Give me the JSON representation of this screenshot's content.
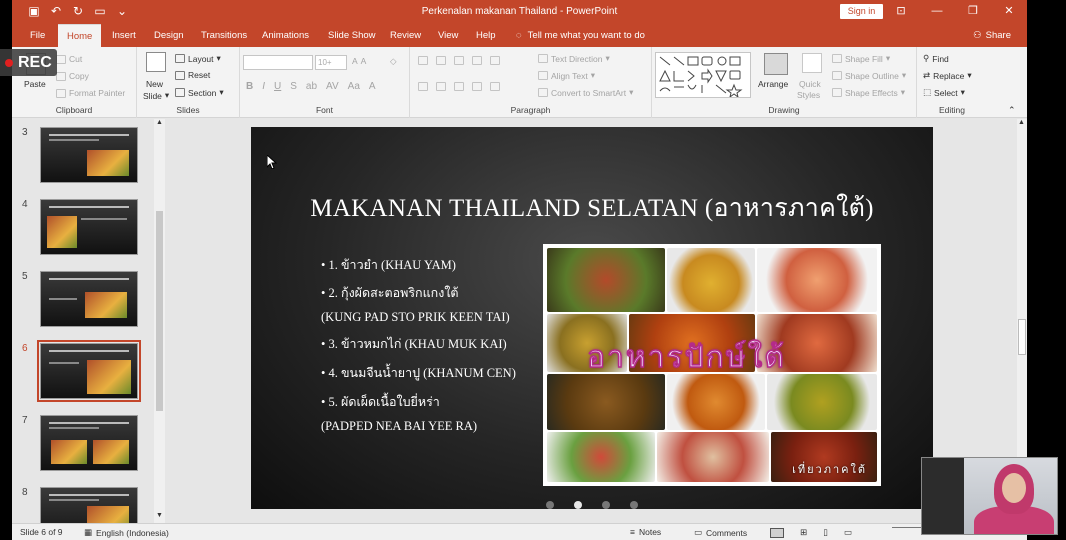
{
  "app": {
    "window_title": "Perkenalan makanan Thailand  -  PowerPoint",
    "sign_in": "Sign in",
    "share": "Share",
    "tell_me": "Tell me what you want to do"
  },
  "tabs": [
    "File",
    "Home",
    "Insert",
    "Design",
    "Transitions",
    "Animations",
    "Slide Show",
    "Review",
    "View",
    "Help"
  ],
  "active_tab": "Home",
  "ribbon": {
    "clipboard": {
      "label": "Clipboard",
      "paste": "Paste",
      "cut": "Cut",
      "copy": "Copy",
      "format_painter": "Format Painter"
    },
    "slides": {
      "label": "Slides",
      "new_slide_1": "New",
      "new_slide_2": "Slide",
      "layout": "Layout",
      "reset": "Reset",
      "section": "Section"
    },
    "font": {
      "label": "Font",
      "size": "10+"
    },
    "paragraph": {
      "label": "Paragraph",
      "text_direction": "Text Direction",
      "align_text": "Align Text",
      "smartart": "Convert to SmartArt"
    },
    "drawing": {
      "label": "Drawing",
      "arrange": "Arrange",
      "quick_styles_1": "Quick",
      "quick_styles_2": "Styles",
      "shape_fill": "Shape Fill",
      "shape_outline": "Shape Outline",
      "shape_effects": "Shape Effects"
    },
    "editing": {
      "label": "Editing",
      "find": "Find",
      "replace": "Replace",
      "select": "Select"
    }
  },
  "thumbnails": [
    {
      "num": "3",
      "active": false
    },
    {
      "num": "4",
      "active": false
    },
    {
      "num": "5",
      "active": false
    },
    {
      "num": "6",
      "active": true
    },
    {
      "num": "7",
      "active": false
    },
    {
      "num": "8",
      "active": false
    }
  ],
  "slide": {
    "title": "MAKANAN THAILAND SELATAN (อาหารภาคใต้)",
    "bullets": [
      "•  1. ข้าวยำ (KHAU YAM)",
      "•  2. กุ้งผัดสะตอพริกแกงใต้",
      "(KUNG PAD STO PRIK KEEN TAI)",
      "•  3. ข้าวหมกไก่ (KHAU MUK KAI)",
      "•  4. ขนมจีนน้ำยาปู (KHANUM CEN)",
      "•  5. ผัดเผ็ดเนื้อใบยี่หร่า",
      "(PADPED NEA BAI YEE RA)"
    ],
    "image_overlay": "อาหารปักษ์ใต้",
    "image_footer": "เที่ยวภาคใต้"
  },
  "status": {
    "slide_info": "Slide 6 of 9",
    "language": "English (Indonesia)",
    "notes": "Notes",
    "comments": "Comments"
  },
  "recording": {
    "label": "REC"
  },
  "colors": {
    "accent": "#c3462a",
    "ribbon_bg": "#f3f3f3",
    "rec_dot": "#e02020"
  }
}
